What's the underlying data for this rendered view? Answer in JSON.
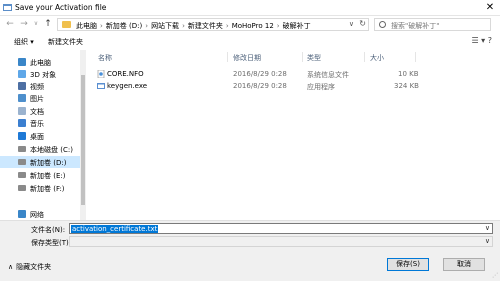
{
  "window": {
    "title": "Save your Activation file",
    "close_glyph": "✕"
  },
  "navigation": {
    "back_glyph": "←",
    "forward_glyph": "→",
    "history_glyph": "∨",
    "up_glyph": "↑"
  },
  "address": {
    "crumbs": [
      "此电脑",
      "新加卷 (D:)",
      "网站下载",
      "新建文件夹",
      "MoHoPro 12",
      "破解补丁"
    ],
    "separator": "›",
    "dropdown_glyph": "∨",
    "refresh_glyph": "↻"
  },
  "search": {
    "placeholder": "搜索\"破解补丁\""
  },
  "toolbar": {
    "organize": "组织 ▾",
    "new_folder": "新建文件夹",
    "view_glyphs": "☰ ▾  ?"
  },
  "sidebar": {
    "items": [
      {
        "label": "此电脑",
        "icon": "computer-icon",
        "color": "#3a86c8"
      },
      {
        "label": "3D 对象",
        "icon": "3d-objects-icon",
        "color": "#5ea7e8"
      },
      {
        "label": "视频",
        "icon": "video-icon",
        "color": "#4d6fa3"
      },
      {
        "label": "图片",
        "icon": "pictures-icon",
        "color": "#4d8fcc"
      },
      {
        "label": "文档",
        "icon": "documents-icon",
        "color": "#9bb3cf"
      },
      {
        "label": "音乐",
        "icon": "music-icon",
        "color": "#3b7fd0"
      },
      {
        "label": "桌面",
        "icon": "desktop-icon",
        "color": "#1e79d6"
      },
      {
        "label": "本地磁盘 (C:)",
        "icon": "drive-icon",
        "color": "#8a8a8a"
      },
      {
        "label": "新加卷 (D:)",
        "icon": "drive-icon",
        "color": "#8a8a8a",
        "selected": true
      },
      {
        "label": "新加卷 (E:)",
        "icon": "drive-icon",
        "color": "#8a8a8a"
      },
      {
        "label": "新加卷 (F:)",
        "icon": "drive-icon",
        "color": "#8a8a8a"
      },
      {
        "label": "网络",
        "icon": "network-icon",
        "color": "#3a86c8"
      }
    ]
  },
  "columns": {
    "name": "名称",
    "modified": "修改日期",
    "type": "类型",
    "size": "大小"
  },
  "files": [
    {
      "name": "CORE.NFO",
      "modified": "2016/8/29 0:28",
      "type": "系统信息文件",
      "size": "10 KB",
      "icon": "nfo-file-icon"
    },
    {
      "name": "keygen.exe",
      "modified": "2016/8/29 0:28",
      "type": "应用程序",
      "size": "324 KB",
      "icon": "exe-file-icon"
    }
  ],
  "form": {
    "filename_label": "文件名(N):",
    "filename_value": "activation_certificate.txt",
    "filetype_label": "保存类型(T):",
    "dropdown_glyph": "∨"
  },
  "footer": {
    "hide_folders": "隐藏文件夹",
    "hide_chevron": "∧",
    "save": "保存(S)",
    "cancel": "取消",
    "grip": "⋰"
  }
}
